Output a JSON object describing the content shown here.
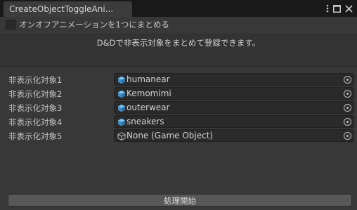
{
  "window": {
    "tab_title": "CreateObjectToggleAni...",
    "icons": [
      "kebab-menu-icon",
      "maximize-icon",
      "close-icon"
    ]
  },
  "toggle": {
    "label": "オンオフアニメーションを1つにまとめる",
    "checked": false
  },
  "help": {
    "text": "D&Dで非表示対象をまとめて登録できます。"
  },
  "fields": [
    {
      "label": "非表示化対象1",
      "value": "humanear",
      "icon": "prefab-cube-icon",
      "assigned": true
    },
    {
      "label": "非表示化対象2",
      "value": "Kemomimi",
      "icon": "prefab-cube-icon",
      "assigned": true
    },
    {
      "label": "非表示化対象3",
      "value": "outerwear",
      "icon": "prefab-cube-icon",
      "assigned": true
    },
    {
      "label": "非表示化対象4",
      "value": "sneakers",
      "icon": "prefab-cube-icon",
      "assigned": true
    },
    {
      "label": "非表示化対象5",
      "value": "None (Game Object)",
      "icon": "gameobject-cube-icon",
      "assigned": false
    }
  ],
  "actions": {
    "run_label": "処理開始"
  },
  "colors": {
    "panel_bg": "#383838",
    "field_bg": "#2a2a2a",
    "button_bg": "#585858",
    "prefab_icon": "#4a9fd8"
  }
}
